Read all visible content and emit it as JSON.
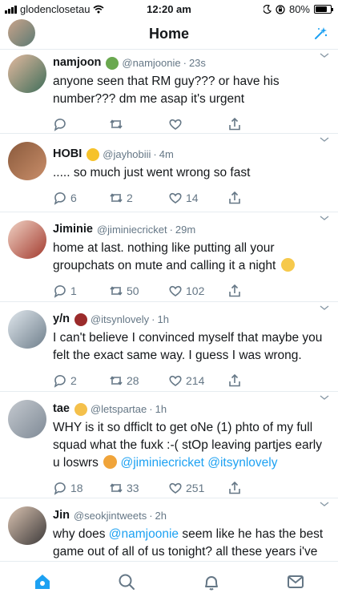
{
  "status_bar": {
    "carrier": "glodenclosetau",
    "time": "12:20 am",
    "battery": "80%",
    "battery_level": 0.8
  },
  "header": {
    "title": "Home",
    "icons": [
      "avatar",
      "sparkle-icon"
    ]
  },
  "tweets": [
    {
      "name": "namjoon",
      "handle": "@namjoonie",
      "time": "23s",
      "text": "anyone seen that RM guy??? or have his number??? dm me asap it's urgent",
      "replies": "",
      "retweets": "",
      "likes": "",
      "emoji_color": "#6aa84f",
      "avatar_colors": [
        "#e3b99f",
        "#3f6e5a"
      ]
    },
    {
      "name": "HOBI",
      "handle": "@jayhobiii",
      "time": "4m",
      "text": "..... so much just went wrong so fast",
      "replies": "6",
      "retweets": "2",
      "likes": "14",
      "emoji_color": "#f6c22a",
      "avatar_colors": [
        "#8a5a3c",
        "#c98e6a"
      ]
    },
    {
      "name": "Jiminie",
      "handle": "@jiminiecricket",
      "time": "29m",
      "text_before": "home at last. nothing like putting all your groupchats on mute and calling it a night",
      "replies": "1",
      "retweets": "50",
      "likes": "102",
      "avatar_colors": [
        "#f0d2c4",
        "#a33b2f"
      ]
    },
    {
      "name": "y/n",
      "handle": "@itsynlovely",
      "time": "1h",
      "text": "I can't believe I convinced myself that maybe you felt the exact same way. I guess I was wrong.",
      "replies": "2",
      "retweets": "28",
      "likes": "214",
      "emoji_color": "#9b2b2b",
      "avatar_colors": [
        "#dfe6ec",
        "#6f7f8c"
      ]
    },
    {
      "name": "tae",
      "handle": "@letspartae",
      "time": "1h",
      "text_before": "WHY is it so dfficlt to get oNe (1) phto of my full squad what the fuxk :-( stOp leaving partjes early u loswrs",
      "mention_1": "@jiminiecricket",
      "mention_2": "@itsynlovely",
      "replies": "18",
      "retweets": "33",
      "likes": "251",
      "emoji_color": "#f4c04b",
      "avatar_colors": [
        "#c4c9cf",
        "#7f8a96"
      ]
    },
    {
      "name": "Jin",
      "handle": "@seokjintweets",
      "time": "2h",
      "text_before": "why does",
      "mention_1": "@namjoonie",
      "text_after": "seem like he has the best game out of all of us tonight? all these years i've never seen him talking to this many girls lmao",
      "avatar_colors": [
        "#d9c2b0",
        "#3d3a3a"
      ]
    }
  ],
  "tabbar": {
    "items": [
      "home-icon",
      "search-icon",
      "notifications-icon",
      "messages-icon"
    ],
    "accent": "#1da1f2",
    "inactive": "#657786"
  }
}
